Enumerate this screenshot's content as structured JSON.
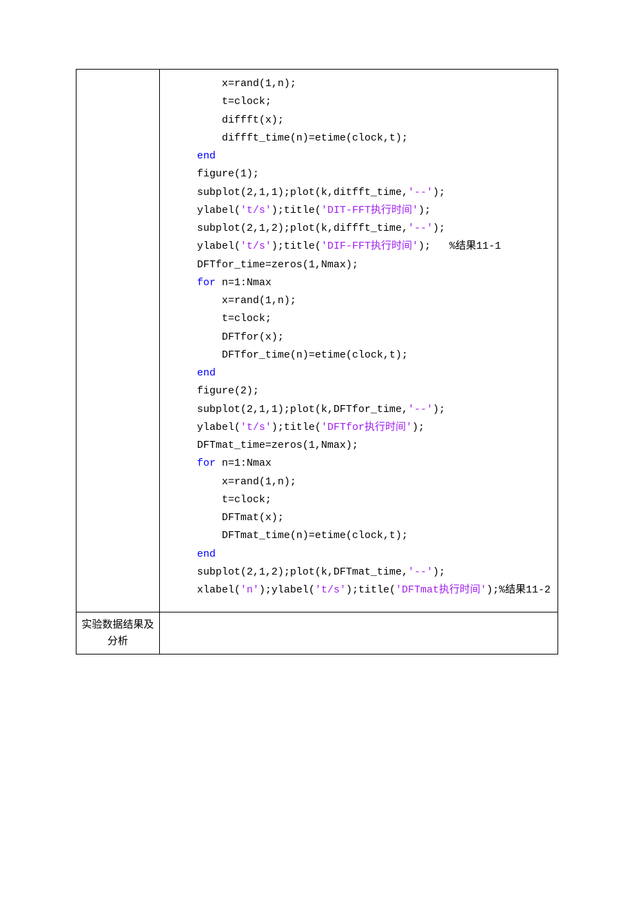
{
  "row2_label": "实验数据结果及分析",
  "code": {
    "lines": [
      {
        "indent": 2,
        "segs": [
          {
            "t": "x=rand(1,n);"
          }
        ]
      },
      {
        "indent": 2,
        "segs": [
          {
            "t": "t=clock;"
          }
        ]
      },
      {
        "indent": 2,
        "segs": [
          {
            "t": "diffft(x);"
          }
        ]
      },
      {
        "indent": 2,
        "segs": [
          {
            "t": "diffft_time(n)=etime(clock,t);"
          }
        ]
      },
      {
        "indent": 1,
        "segs": [
          {
            "t": "end",
            "c": "kw"
          }
        ]
      },
      {
        "indent": 1,
        "segs": [
          {
            "t": "figure(1);"
          }
        ]
      },
      {
        "indent": 1,
        "segs": [
          {
            "t": "subplot(2,1,1);plot(k,ditfft_time,"
          },
          {
            "t": "'--'",
            "c": "str"
          },
          {
            "t": ");"
          }
        ]
      },
      {
        "indent": 1,
        "segs": [
          {
            "t": "ylabel("
          },
          {
            "t": "'t/s'",
            "c": "str"
          },
          {
            "t": ");title("
          },
          {
            "t": "'DIT-FFT执行时间'",
            "c": "str"
          },
          {
            "t": ");"
          }
        ]
      },
      {
        "indent": 1,
        "segs": [
          {
            "t": "subplot(2,1,2);plot(k,diffft_time,"
          },
          {
            "t": "'--'",
            "c": "str"
          },
          {
            "t": ");"
          }
        ]
      },
      {
        "indent": 1,
        "segs": [
          {
            "t": "ylabel("
          },
          {
            "t": "'t/s'",
            "c": "str"
          },
          {
            "t": ");title("
          },
          {
            "t": "'DIF-FFT执行时间'",
            "c": "str"
          },
          {
            "t": ");   %结果11-1"
          }
        ]
      },
      {
        "indent": 1,
        "segs": [
          {
            "t": "DFTfor_time=zeros(1,Nmax);"
          }
        ]
      },
      {
        "indent": 1,
        "segs": [
          {
            "t": "for ",
            "c": "kw"
          },
          {
            "t": "n=1:Nmax"
          }
        ]
      },
      {
        "indent": 2,
        "segs": [
          {
            "t": "x=rand(1,n);"
          }
        ]
      },
      {
        "indent": 2,
        "segs": [
          {
            "t": "t=clock;"
          }
        ]
      },
      {
        "indent": 2,
        "segs": [
          {
            "t": "DFTfor(x);"
          }
        ]
      },
      {
        "indent": 2,
        "segs": [
          {
            "t": "DFTfor_time(n)=etime(clock,t);"
          }
        ]
      },
      {
        "indent": 1,
        "segs": [
          {
            "t": "end",
            "c": "kw"
          }
        ]
      },
      {
        "indent": 1,
        "segs": [
          {
            "t": "figure(2);"
          }
        ]
      },
      {
        "indent": 1,
        "segs": [
          {
            "t": "subplot(2,1,1);plot(k,DFTfor_time,"
          },
          {
            "t": "'--'",
            "c": "str"
          },
          {
            "t": ");"
          }
        ]
      },
      {
        "indent": 1,
        "segs": [
          {
            "t": "ylabel("
          },
          {
            "t": "'t/s'",
            "c": "str"
          },
          {
            "t": ");title("
          },
          {
            "t": "'DFTfor执行时间'",
            "c": "str"
          },
          {
            "t": ");"
          }
        ]
      },
      {
        "indent": 1,
        "segs": [
          {
            "t": "DFTmat_time=zeros(1,Nmax);"
          }
        ]
      },
      {
        "indent": 1,
        "segs": [
          {
            "t": "for ",
            "c": "kw"
          },
          {
            "t": "n=1:Nmax"
          }
        ]
      },
      {
        "indent": 2,
        "segs": [
          {
            "t": "x=rand(1,n);"
          }
        ]
      },
      {
        "indent": 2,
        "segs": [
          {
            "t": "t=clock;"
          }
        ]
      },
      {
        "indent": 2,
        "segs": [
          {
            "t": "DFTmat(x);"
          }
        ]
      },
      {
        "indent": 2,
        "segs": [
          {
            "t": "DFTmat_time(n)=etime(clock,t);"
          }
        ]
      },
      {
        "indent": 1,
        "segs": [
          {
            "t": "end",
            "c": "kw"
          }
        ]
      },
      {
        "indent": 1,
        "segs": [
          {
            "t": "subplot(2,1,2);plot(k,DFTmat_time,"
          },
          {
            "t": "'--'",
            "c": "str"
          },
          {
            "t": ");"
          }
        ]
      },
      {
        "indent": 1,
        "segs": [
          {
            "t": "xlabel("
          },
          {
            "t": "'n'",
            "c": "str"
          },
          {
            "t": ");ylabel("
          },
          {
            "t": "'t/s'",
            "c": "str"
          },
          {
            "t": ");title("
          },
          {
            "t": "'DFTmat执行时间'",
            "c": "str"
          },
          {
            "t": ");%结果11-2"
          }
        ]
      }
    ]
  }
}
